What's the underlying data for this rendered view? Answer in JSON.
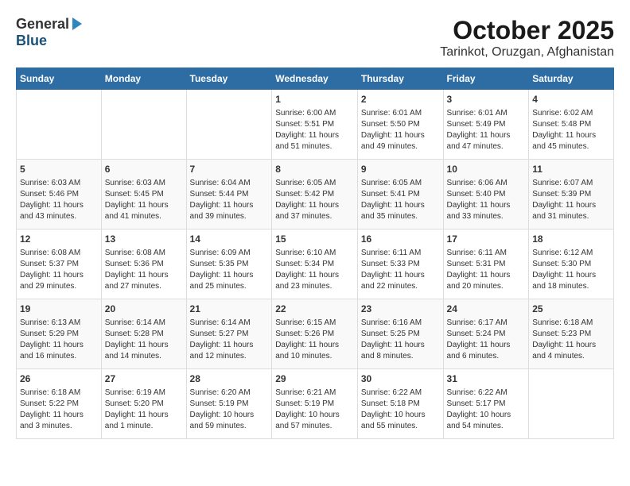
{
  "header": {
    "logo": {
      "general": "General",
      "blue": "Blue"
    },
    "title": "October 2025",
    "location": "Tarinkot, Oruzgan, Afghanistan"
  },
  "weekdays": [
    "Sunday",
    "Monday",
    "Tuesday",
    "Wednesday",
    "Thursday",
    "Friday",
    "Saturday"
  ],
  "weeks": [
    {
      "days": [
        {
          "num": "",
          "info": ""
        },
        {
          "num": "",
          "info": ""
        },
        {
          "num": "",
          "info": ""
        },
        {
          "num": "1",
          "info": "Sunrise: 6:00 AM\nSunset: 5:51 PM\nDaylight: 11 hours\nand 51 minutes."
        },
        {
          "num": "2",
          "info": "Sunrise: 6:01 AM\nSunset: 5:50 PM\nDaylight: 11 hours\nand 49 minutes."
        },
        {
          "num": "3",
          "info": "Sunrise: 6:01 AM\nSunset: 5:49 PM\nDaylight: 11 hours\nand 47 minutes."
        },
        {
          "num": "4",
          "info": "Sunrise: 6:02 AM\nSunset: 5:48 PM\nDaylight: 11 hours\nand 45 minutes."
        }
      ]
    },
    {
      "days": [
        {
          "num": "5",
          "info": "Sunrise: 6:03 AM\nSunset: 5:46 PM\nDaylight: 11 hours\nand 43 minutes."
        },
        {
          "num": "6",
          "info": "Sunrise: 6:03 AM\nSunset: 5:45 PM\nDaylight: 11 hours\nand 41 minutes."
        },
        {
          "num": "7",
          "info": "Sunrise: 6:04 AM\nSunset: 5:44 PM\nDaylight: 11 hours\nand 39 minutes."
        },
        {
          "num": "8",
          "info": "Sunrise: 6:05 AM\nSunset: 5:42 PM\nDaylight: 11 hours\nand 37 minutes."
        },
        {
          "num": "9",
          "info": "Sunrise: 6:05 AM\nSunset: 5:41 PM\nDaylight: 11 hours\nand 35 minutes."
        },
        {
          "num": "10",
          "info": "Sunrise: 6:06 AM\nSunset: 5:40 PM\nDaylight: 11 hours\nand 33 minutes."
        },
        {
          "num": "11",
          "info": "Sunrise: 6:07 AM\nSunset: 5:39 PM\nDaylight: 11 hours\nand 31 minutes."
        }
      ]
    },
    {
      "days": [
        {
          "num": "12",
          "info": "Sunrise: 6:08 AM\nSunset: 5:37 PM\nDaylight: 11 hours\nand 29 minutes."
        },
        {
          "num": "13",
          "info": "Sunrise: 6:08 AM\nSunset: 5:36 PM\nDaylight: 11 hours\nand 27 minutes."
        },
        {
          "num": "14",
          "info": "Sunrise: 6:09 AM\nSunset: 5:35 PM\nDaylight: 11 hours\nand 25 minutes."
        },
        {
          "num": "15",
          "info": "Sunrise: 6:10 AM\nSunset: 5:34 PM\nDaylight: 11 hours\nand 23 minutes."
        },
        {
          "num": "16",
          "info": "Sunrise: 6:11 AM\nSunset: 5:33 PM\nDaylight: 11 hours\nand 22 minutes."
        },
        {
          "num": "17",
          "info": "Sunrise: 6:11 AM\nSunset: 5:31 PM\nDaylight: 11 hours\nand 20 minutes."
        },
        {
          "num": "18",
          "info": "Sunrise: 6:12 AM\nSunset: 5:30 PM\nDaylight: 11 hours\nand 18 minutes."
        }
      ]
    },
    {
      "days": [
        {
          "num": "19",
          "info": "Sunrise: 6:13 AM\nSunset: 5:29 PM\nDaylight: 11 hours\nand 16 minutes."
        },
        {
          "num": "20",
          "info": "Sunrise: 6:14 AM\nSunset: 5:28 PM\nDaylight: 11 hours\nand 14 minutes."
        },
        {
          "num": "21",
          "info": "Sunrise: 6:14 AM\nSunset: 5:27 PM\nDaylight: 11 hours\nand 12 minutes."
        },
        {
          "num": "22",
          "info": "Sunrise: 6:15 AM\nSunset: 5:26 PM\nDaylight: 11 hours\nand 10 minutes."
        },
        {
          "num": "23",
          "info": "Sunrise: 6:16 AM\nSunset: 5:25 PM\nDaylight: 11 hours\nand 8 minutes."
        },
        {
          "num": "24",
          "info": "Sunrise: 6:17 AM\nSunset: 5:24 PM\nDaylight: 11 hours\nand 6 minutes."
        },
        {
          "num": "25",
          "info": "Sunrise: 6:18 AM\nSunset: 5:23 PM\nDaylight: 11 hours\nand 4 minutes."
        }
      ]
    },
    {
      "days": [
        {
          "num": "26",
          "info": "Sunrise: 6:18 AM\nSunset: 5:22 PM\nDaylight: 11 hours\nand 3 minutes."
        },
        {
          "num": "27",
          "info": "Sunrise: 6:19 AM\nSunset: 5:20 PM\nDaylight: 11 hours\nand 1 minute."
        },
        {
          "num": "28",
          "info": "Sunrise: 6:20 AM\nSunset: 5:19 PM\nDaylight: 10 hours\nand 59 minutes."
        },
        {
          "num": "29",
          "info": "Sunrise: 6:21 AM\nSunset: 5:19 PM\nDaylight: 10 hours\nand 57 minutes."
        },
        {
          "num": "30",
          "info": "Sunrise: 6:22 AM\nSunset: 5:18 PM\nDaylight: 10 hours\nand 55 minutes."
        },
        {
          "num": "31",
          "info": "Sunrise: 6:22 AM\nSunset: 5:17 PM\nDaylight: 10 hours\nand 54 minutes."
        },
        {
          "num": "",
          "info": ""
        }
      ]
    }
  ]
}
